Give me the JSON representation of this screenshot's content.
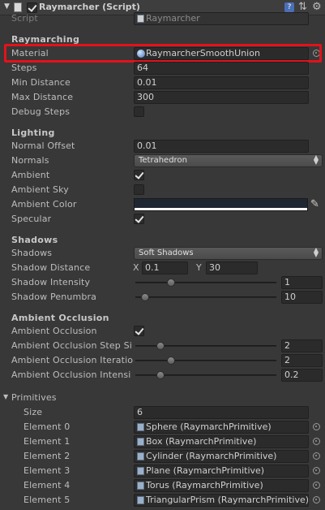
{
  "header": {
    "title": "Raymarcher (Script)",
    "enabled": true
  },
  "script_row": {
    "label": "Script",
    "value": "Raymarcher"
  },
  "raymarching": {
    "section": "Raymarching",
    "material_label": "Material",
    "material_value": "RaymarcherSmoothUnion",
    "steps_label": "Steps",
    "steps_value": "64",
    "min_distance_label": "Min Distance",
    "min_distance_value": "0.01",
    "max_distance_label": "Max Distance",
    "max_distance_value": "300",
    "debug_steps_label": "Debug Steps",
    "debug_steps_checked": false
  },
  "lighting": {
    "section": "Lighting",
    "normal_offset_label": "Normal Offset",
    "normal_offset_value": "0.01",
    "normals_label": "Normals",
    "normals_value": "Tetrahedron",
    "ambient_label": "Ambient",
    "ambient_checked": true,
    "ambient_sky_label": "Ambient Sky",
    "ambient_sky_checked": false,
    "ambient_color_label": "Ambient Color",
    "ambient_color": "#1f2733",
    "specular_label": "Specular",
    "specular_checked": true
  },
  "shadows": {
    "section": "Shadows",
    "shadows_label": "Shadows",
    "shadows_value": "Soft Shadows",
    "distance_label": "Shadow Distance",
    "distance_x_label": "X",
    "distance_x": "0.1",
    "distance_y_label": "Y",
    "distance_y": "30",
    "intensity_label": "Shadow Intensity",
    "intensity_value": "1",
    "intensity_fraction": 0.25,
    "penumbra_label": "Shadow Penumbra",
    "penumbra_value": "10",
    "penumbra_fraction": 0.07
  },
  "ao": {
    "section": "Ambient Occlusion",
    "enabled_label": "Ambient Occlusion",
    "enabled_checked": true,
    "step_label": "Ambient Occlusion Step Si",
    "step_value": "2",
    "step_fraction": 0.18,
    "iter_label": "Ambient Occlusion Iteratio",
    "iter_value": "2",
    "iter_fraction": 0.25,
    "intensity_label": "Ambient Occlusion Intensi",
    "intensity_value": "0.2",
    "intensity_fraction": 0.18
  },
  "primitives": {
    "section": "Primitives",
    "size_label": "Size",
    "size_value": "6",
    "elements": [
      {
        "label": "Element 0",
        "value": "Sphere (RaymarchPrimitive)"
      },
      {
        "label": "Element 1",
        "value": "Box (RaymarchPrimitive)"
      },
      {
        "label": "Element 2",
        "value": "Cylinder (RaymarchPrimitive)"
      },
      {
        "label": "Element 3",
        "value": "Plane (RaymarchPrimitive)"
      },
      {
        "label": "Element 4",
        "value": "Torus (RaymarchPrimitive)"
      },
      {
        "label": "Element 5",
        "value": "TriangularPrism (RaymarchPrimitive)"
      }
    ]
  },
  "colors": {
    "background": "#383838",
    "highlight": "#e3121b"
  }
}
